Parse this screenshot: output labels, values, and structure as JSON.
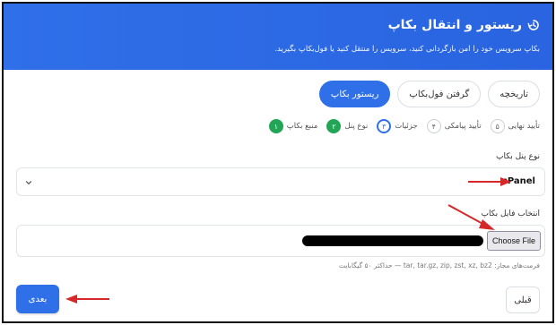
{
  "header": {
    "title": "ریستور و انتقال بکاپ",
    "subtitle": "بکاپ سرویس خود را امن بازگردانی کنید، سرویس را منتقل کنید یا فول‌بکاپ بگیرید."
  },
  "tabs": [
    {
      "label": "ریستور بکاپ",
      "active": true
    },
    {
      "label": "گرفتن فول‌بکاپ",
      "active": false
    },
    {
      "label": "تاریخچه",
      "active": false
    }
  ],
  "steps": [
    {
      "num": "۱",
      "label": "منبع بکاپ",
      "state": "done"
    },
    {
      "num": "۲",
      "label": "نوع پنل",
      "state": "done"
    },
    {
      "num": "۳",
      "label": "جزئیات",
      "state": "current"
    },
    {
      "num": "۴",
      "label": "تأیید پیامکی",
      "state": "pending"
    },
    {
      "num": "۵",
      "label": "تأیید نهایی",
      "state": "pending"
    }
  ],
  "panel_type": {
    "label": "نوع پنل بکاپ",
    "selected": "cPanel"
  },
  "file_select": {
    "label": "انتخاب فایل بکاپ",
    "button": "Choose File",
    "hint": "فرمت‌های مجاز: tar, tar.gz, zip, zst, xz, bz2 — حداکثر ۵۰ گیگابایت"
  },
  "actions": {
    "next": "بعدی",
    "prev": "قبلی"
  },
  "colors": {
    "primary": "#2f6fe8",
    "done": "#22a556",
    "annotation": "#d62828"
  }
}
